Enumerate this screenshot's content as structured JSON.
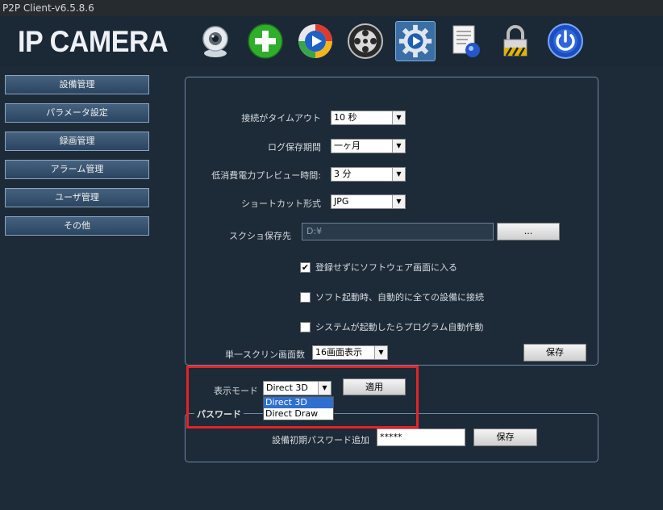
{
  "window": {
    "title": "P2P Client-v6.5.8.6"
  },
  "header": {
    "logo": "IP CAMERA",
    "icons": [
      {
        "name": "camera-icon"
      },
      {
        "name": "add-icon"
      },
      {
        "name": "play-icon"
      },
      {
        "name": "reel-icon"
      },
      {
        "name": "settings-icon",
        "active": true
      },
      {
        "name": "log-icon"
      },
      {
        "name": "lock-icon"
      },
      {
        "name": "power-icon"
      }
    ]
  },
  "sidebar": {
    "items": [
      {
        "label": "設備管理"
      },
      {
        "label": "パラメータ設定"
      },
      {
        "label": "録画管理"
      },
      {
        "label": "アラーム管理"
      },
      {
        "label": "ユーザ管理"
      },
      {
        "label": "その他"
      }
    ]
  },
  "settings": {
    "timeout": {
      "label": "接続がタイムアウト",
      "value": "10 秒"
    },
    "log_period": {
      "label": "ログ保存期間",
      "value": "一ヶ月"
    },
    "low_power_preview": {
      "label": "低消費電力プレビュー時間:",
      "value": "3 分"
    },
    "shortcut_format": {
      "label": "ショートカット形式",
      "value": "JPG"
    },
    "screenshot_path": {
      "label": "スクショ保存先",
      "value": "D:¥",
      "browse_label": "..."
    },
    "checks": [
      {
        "label": "登録せずにソフトウェア画面に入る",
        "checked": true,
        "mark": "✔"
      },
      {
        "label": "ソフト起動時、自動的に全ての設備に接続",
        "checked": false,
        "mark": ""
      },
      {
        "label": "システムが起動したらプログラム自動作動",
        "checked": false,
        "mark": ""
      }
    ],
    "single_screen": {
      "label": "単一スクリン画面数",
      "value": "16画面表示"
    },
    "save_label": "保存"
  },
  "display_mode": {
    "label": "表示モード",
    "value": "Direct 3D",
    "apply_label": "適用",
    "options": [
      "Direct 3D",
      "Direct Draw"
    ],
    "selected_index": 0
  },
  "password": {
    "legend": "パスワード",
    "label": "設備初期パスワード追加",
    "value": "*****",
    "save_label": "保存"
  },
  "colors": {
    "background": "#1d2a37",
    "highlight": "#e3232a",
    "selected_option": "#2f6fcf"
  }
}
